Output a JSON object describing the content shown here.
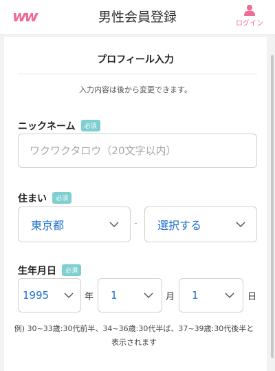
{
  "header": {
    "logo_text": "ww",
    "title": "男性会員登録",
    "login_label": "ログイン",
    "accent_color": "#f06a93"
  },
  "form": {
    "section_title": "プロフィール入力",
    "notice": "入力内容は後から変更できます。",
    "required_label": "必須",
    "nickname": {
      "label": "ニックネーム",
      "placeholder": "ワクワクタロウ（20文字以内）",
      "value": ""
    },
    "residence": {
      "label": "住まい",
      "prefecture": "東京都",
      "separator": "-",
      "city": "選択する"
    },
    "birthday": {
      "label": "生年月日",
      "year": "1995",
      "year_unit": "年",
      "month": "1",
      "month_unit": "月",
      "day": "1",
      "day_unit": "日",
      "hint": "例) 30~33歳:30代前半、34~36歳:30代半ば、37~39歳:30代後半と表示されます"
    }
  },
  "icons": {
    "login": "person-icon",
    "dropdown": "chevron-down-icon"
  },
  "colors": {
    "badge": "#7ecfcf",
    "select_value": "#1d6fce"
  }
}
